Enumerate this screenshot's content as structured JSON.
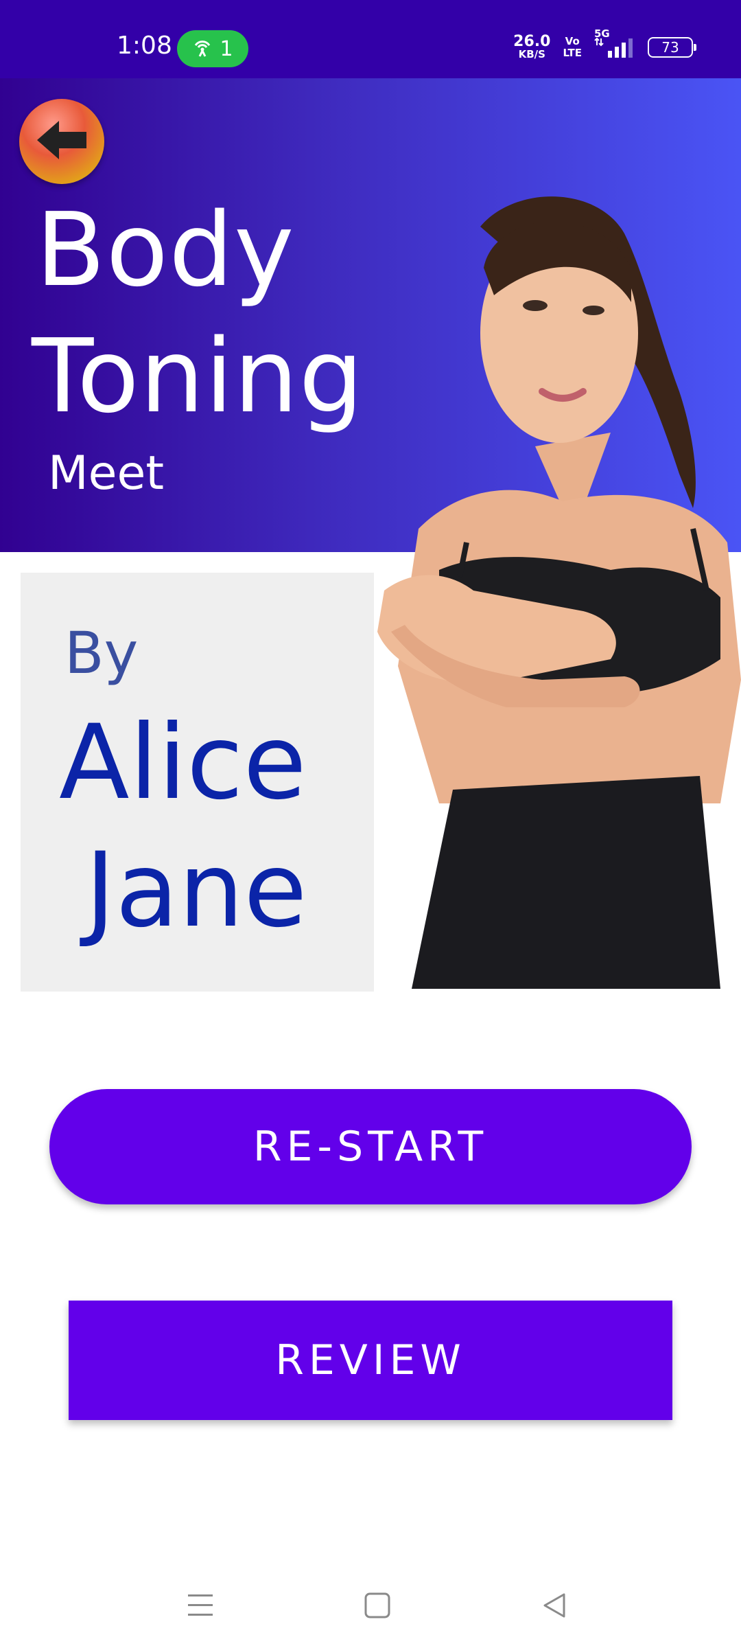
{
  "status_bar": {
    "time": "1:08",
    "hotspot_count": "1",
    "net_speed_value": "26.0",
    "net_speed_unit": "KB/S",
    "volte_top": "Vo",
    "volte_bottom": "LTE",
    "network": "5G",
    "battery": "73"
  },
  "hero": {
    "title_line1": "Body",
    "title_line2": "Toning",
    "subtitle": "Meet"
  },
  "author": {
    "by": "By",
    "first_name": "Alice",
    "last_name": "Jane"
  },
  "actions": {
    "restart_label": "RE-START",
    "review_label": "REVIEW"
  },
  "colors": {
    "status_bar": "#3300a8",
    "hero_start": "#310191",
    "hero_end": "#4a54f5",
    "button": "#6200ea",
    "author_text": "#0b24a8"
  },
  "icons": {
    "back": "back-arrow-icon",
    "hotspot": "hotspot-icon",
    "menu": "menu-icon",
    "home": "home-icon",
    "back_nav": "back-triangle-icon"
  }
}
